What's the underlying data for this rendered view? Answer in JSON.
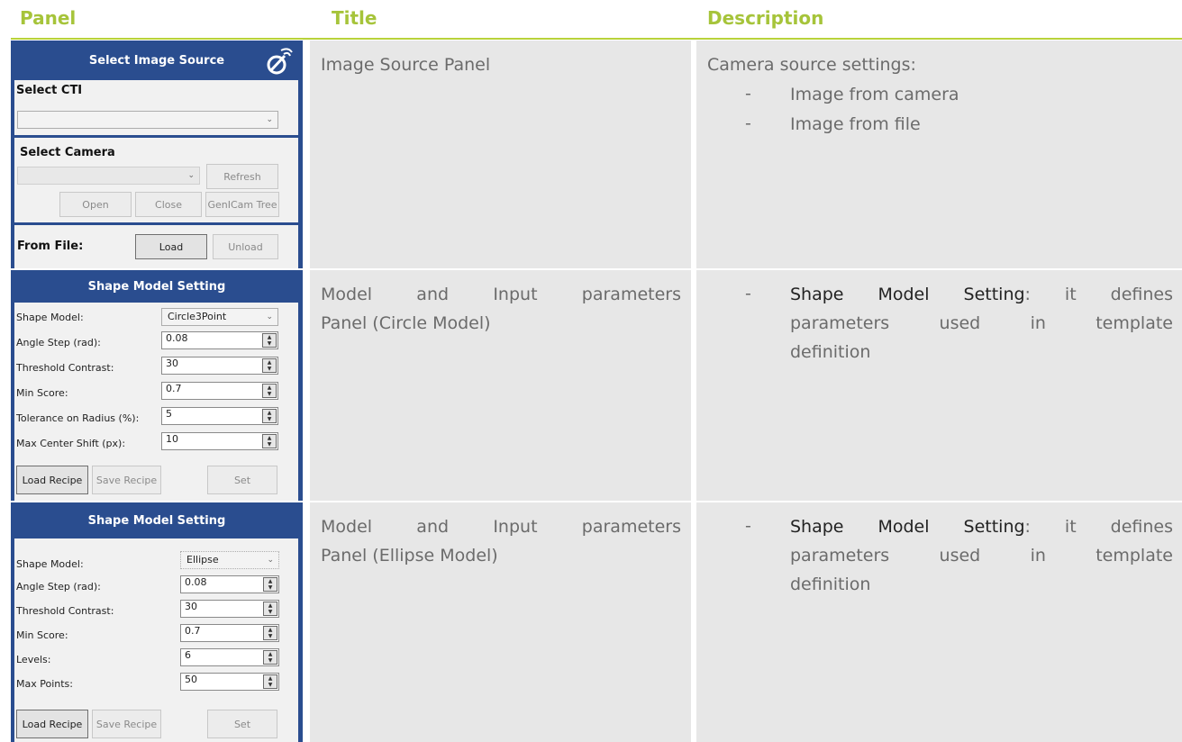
{
  "headers": {
    "panel": "Panel",
    "title": "Title",
    "description": "Description"
  },
  "rows": [
    {
      "title": "Image Source Panel",
      "description_intro": "Camera source settings:",
      "bullets": [
        "Image from camera",
        "Image from file"
      ],
      "panel": {
        "header": "Select Image Source",
        "select_cti_label": "Select CTI",
        "select_cti_value": "",
        "select_camera_label": "Select Camera",
        "camera_value": "",
        "refresh": "Refresh",
        "open": "Open",
        "close": "Close",
        "genicam_tree": "GenICam Tree",
        "from_file_label": "From File:",
        "load": "Load",
        "unload": "Unload"
      }
    },
    {
      "title_line1": "Model and Input parameters",
      "title_line2": "Panel (Circle Model)",
      "bullet_bold": "Shape Model Setting",
      "bullet_rest": ": it defines",
      "bullet_line2": "parameters used in template",
      "bullet_line3": "definition",
      "panel": {
        "header": "Shape Model Setting",
        "shape_model_label": "Shape Model:",
        "shape_model_value": "Circle3Point",
        "fields": [
          {
            "label": "Angle Step (rad):",
            "value": "0.08"
          },
          {
            "label": "Threshold Contrast:",
            "value": "30"
          },
          {
            "label": "Min Score:",
            "value": "0.7"
          },
          {
            "label": "Tolerance on Radius (%):",
            "value": "5"
          },
          {
            "label": "Max Center Shift (px):",
            "value": "10"
          }
        ],
        "load_recipe": "Load Recipe",
        "save_recipe": "Save Recipe",
        "set": "Set"
      }
    },
    {
      "title_line1": "Model and Input parameters",
      "title_line2": "Panel (Ellipse Model)",
      "bullet_bold": "Shape Model Setting",
      "bullet_rest": ": it defines",
      "bullet_line2": "parameters used in template",
      "bullet_line3": "definition",
      "panel": {
        "header": "Shape Model Setting",
        "shape_model_label": "Shape Model:",
        "shape_model_value": "Ellipse",
        "fields": [
          {
            "label": "Angle Step (rad):",
            "value": "0.08"
          },
          {
            "label": "Threshold Contrast:",
            "value": "30"
          },
          {
            "label": "Min Score:",
            "value": "0.7"
          },
          {
            "label": "Levels:",
            "value": "6"
          },
          {
            "label": "Max Points:",
            "value": "50"
          }
        ],
        "load_recipe": "Load Recipe",
        "save_recipe": "Save Recipe",
        "set": "Set"
      }
    }
  ],
  "colors": {
    "header_green": "#a6c43a",
    "panel_blue": "#2a4d8f",
    "cell_gray": "#e7e7e7"
  }
}
